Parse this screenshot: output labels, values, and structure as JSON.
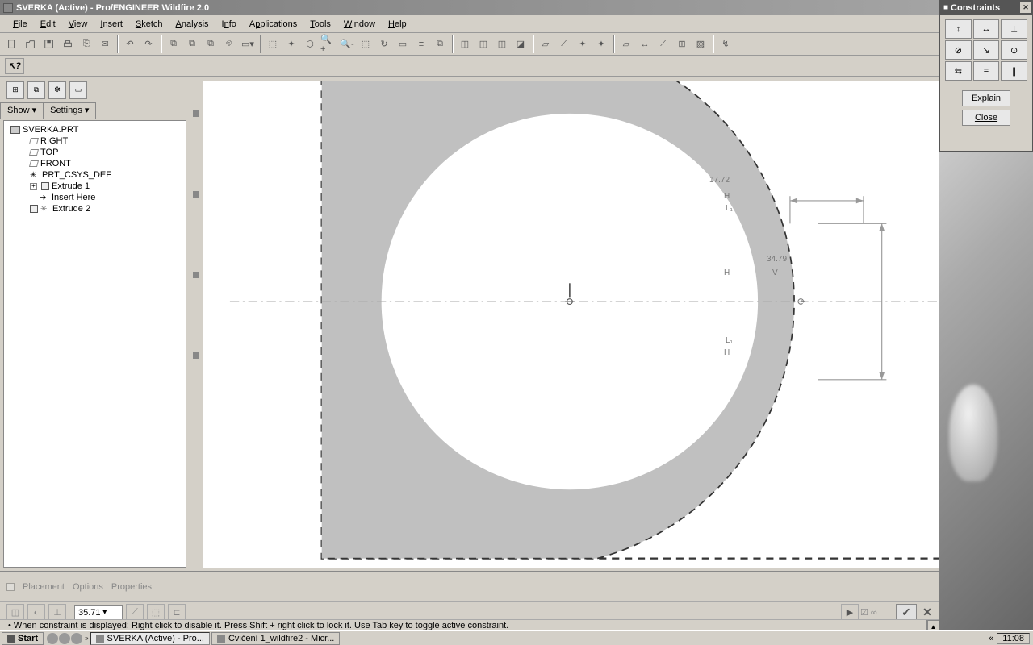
{
  "title": "SVERKA (Active) - Pro/ENGINEER Wildfire 2.0",
  "menu": [
    "File",
    "Edit",
    "View",
    "Insert",
    "Sketch",
    "Analysis",
    "Info",
    "Applications",
    "Tools",
    "Window",
    "Help"
  ],
  "tree": {
    "show": "Show",
    "settings": "Settings",
    "root": "SVERKA.PRT",
    "items": [
      {
        "label": "RIGHT",
        "icon": "plane",
        "lvl": 2
      },
      {
        "label": "TOP",
        "icon": "plane",
        "lvl": 2
      },
      {
        "label": "FRONT",
        "icon": "plane",
        "lvl": 2
      },
      {
        "label": "PRT_CSYS_DEF",
        "icon": "csys",
        "lvl": 2
      },
      {
        "label": "Extrude 1",
        "icon": "ext",
        "lvl": 2,
        "exp": "+"
      },
      {
        "label": "Insert Here",
        "icon": "arrow",
        "lvl": 3
      },
      {
        "label": "Extrude 2",
        "icon": "sketch",
        "lvl": 2
      }
    ]
  },
  "dims": {
    "d1": "17.72",
    "d2": "34.79",
    "h": "H",
    "v": "V",
    "l1": "L₁"
  },
  "dashboard": {
    "labels": [
      "Placement",
      "Options",
      "Properties"
    ],
    "depth": "35.71"
  },
  "message": "• When constraint is displayed: Right click to disable it. Press Shift + right click to lock it. Use Tab key to toggle active constraint.",
  "constraints": {
    "title": "Constraints",
    "explain": "Explain",
    "close": "Close"
  },
  "taskbar": {
    "start": "Start",
    "items": [
      {
        "label": "SVERKA (Active) - Pro...",
        "active": true
      },
      {
        "label": "Cvičení 1_wildfire2 - Micr...",
        "active": false
      }
    ],
    "time": "11:08"
  }
}
